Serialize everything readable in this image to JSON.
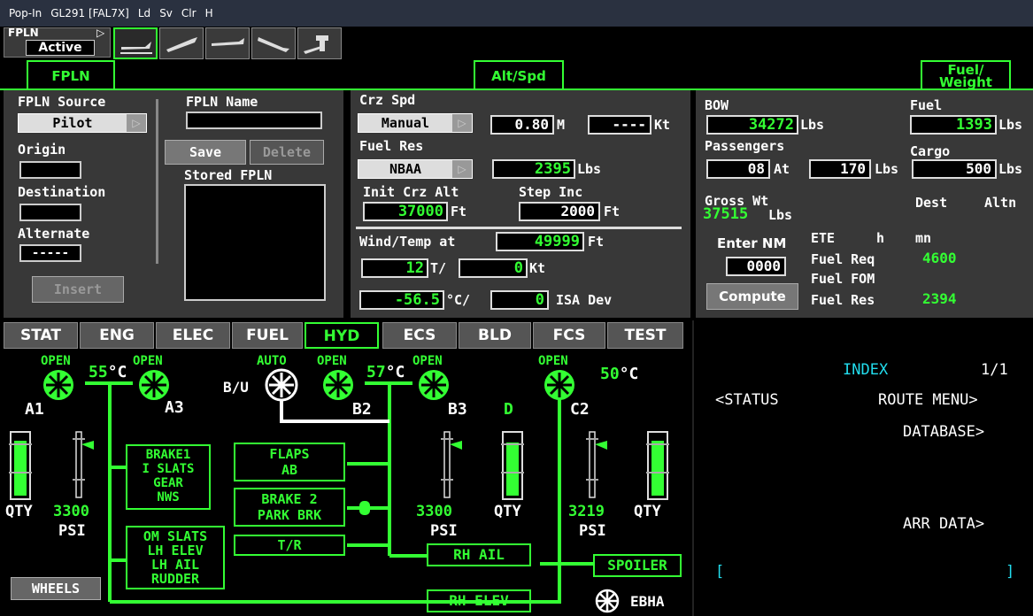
{
  "topbar": {
    "items": [
      "Pop-In",
      "GL291 [FAL7X]",
      "Ld",
      "Sv",
      "Clr",
      "H"
    ]
  },
  "phase": {
    "fpln_label": "FPLN",
    "tri": "▷",
    "status": "Active"
  },
  "tabs": {
    "fpln": "FPLN",
    "altspd": "Alt/Spd",
    "fuel_l1": "Fuel/",
    "fuel_l2": "Weight"
  },
  "fpln": {
    "source_label": "FPLN Source",
    "source_value": "Pilot",
    "origin_label": "Origin",
    "destination_label": "Destination",
    "alternate_label": "Alternate",
    "alternate_value": "-----",
    "insert": "Insert",
    "name_label": "FPLN Name",
    "save": "Save",
    "delete": "Delete",
    "stored_label": "Stored FPLN"
  },
  "altspd": {
    "crz_spd_label": "Crz Spd",
    "crz_mode": "Manual",
    "mach": "0.80",
    "mach_unit": "M",
    "kt_value": "----",
    "kt_unit": "Kt",
    "fuel_res_label": "Fuel Res",
    "fuel_res_mode": "NBAA",
    "fuel_res_value": "2395",
    "fuel_res_unit": "Lbs",
    "init_crz_label": "Init Crz Alt",
    "init_crz_value": "37000",
    "ft": "Ft",
    "step_inc_label": "Step Inc",
    "step_inc_value": "2000",
    "wind_label": "Wind/Temp at",
    "wind_alt": "49999",
    "wind_dir": "12",
    "wind_slash": "T/",
    "wind_spd": "0",
    "kt": "Kt",
    "temp": "-56.5",
    "temp_unit": "°C/",
    "isa": "0",
    "isa_label": "ISA Dev"
  },
  "fuel": {
    "bow_label": "BOW",
    "bow_value": "34272",
    "lbs": "Lbs",
    "fuel_label": "Fuel",
    "fuel_value": "1393",
    "pax_label": "Passengers",
    "pax_value": "08",
    "pax_at": "At",
    "pax_wt": "170",
    "cargo_label": "Cargo",
    "cargo_value": "500",
    "gross_label": "Gross Wt",
    "gross_value": "37515",
    "gross_unit": "Lbs",
    "dest": "Dest",
    "altn": "Altn",
    "enter_nm": "Enter NM",
    "nm_value": "0000",
    "compute": "Compute",
    "ete": "ETE",
    "h": "h",
    "mn": "mn",
    "fuel_req_label": "Fuel Req",
    "fuel_req_value": "4600",
    "fuel_fom_label": "Fuel FOM",
    "fuel_res_label": "Fuel Res",
    "fuel_res_value": "2394"
  },
  "syn_tabs": [
    "STAT",
    "ENG",
    "ELEC",
    "FUEL",
    "HYD",
    "ECS",
    "BLD",
    "FCS",
    "TEST"
  ],
  "hyd": {
    "open": "OPEN",
    "auto": "AUTO",
    "temp_a": "55",
    "temp_b": "57",
    "temp_c": "50",
    "deg": "°C",
    "a1": "A1",
    "a3": "A3",
    "bu": "B/U",
    "b2": "B2",
    "b3": "B3",
    "d": "D",
    "c2": "C2",
    "qty": "QTY",
    "psi": "PSI",
    "psi_a": "3300",
    "psi_b": "3300",
    "psi_c": "3219",
    "box1": [
      "BRAKE1",
      "I SLATS",
      "GEAR",
      "NWS"
    ],
    "box2": [
      "FLAPS",
      "AB"
    ],
    "box3": [
      "BRAKE 2",
      "PARK BRK"
    ],
    "box4": [
      "T/R"
    ],
    "box5": [
      "OM SLATS",
      "LH ELEV",
      "LH AIL",
      "RUDDER"
    ],
    "rh_ail": "RH AIL",
    "spoiler": "SPOILER",
    "rh_elev": "RH ELEV",
    "ebha": "EBHA",
    "wheels": "WHEELS"
  },
  "cdu": {
    "index": "INDEX",
    "page": "1/1",
    "status": "<STATUS",
    "route_menu": "ROUTE MENU>",
    "database": "DATABASE>",
    "arr_data": "ARR DATA>",
    "lbracket": "[",
    "rbracket": "]"
  },
  "colors": {
    "green": "#33ff33",
    "cyan": "#22ddee",
    "panel": "#383838"
  }
}
